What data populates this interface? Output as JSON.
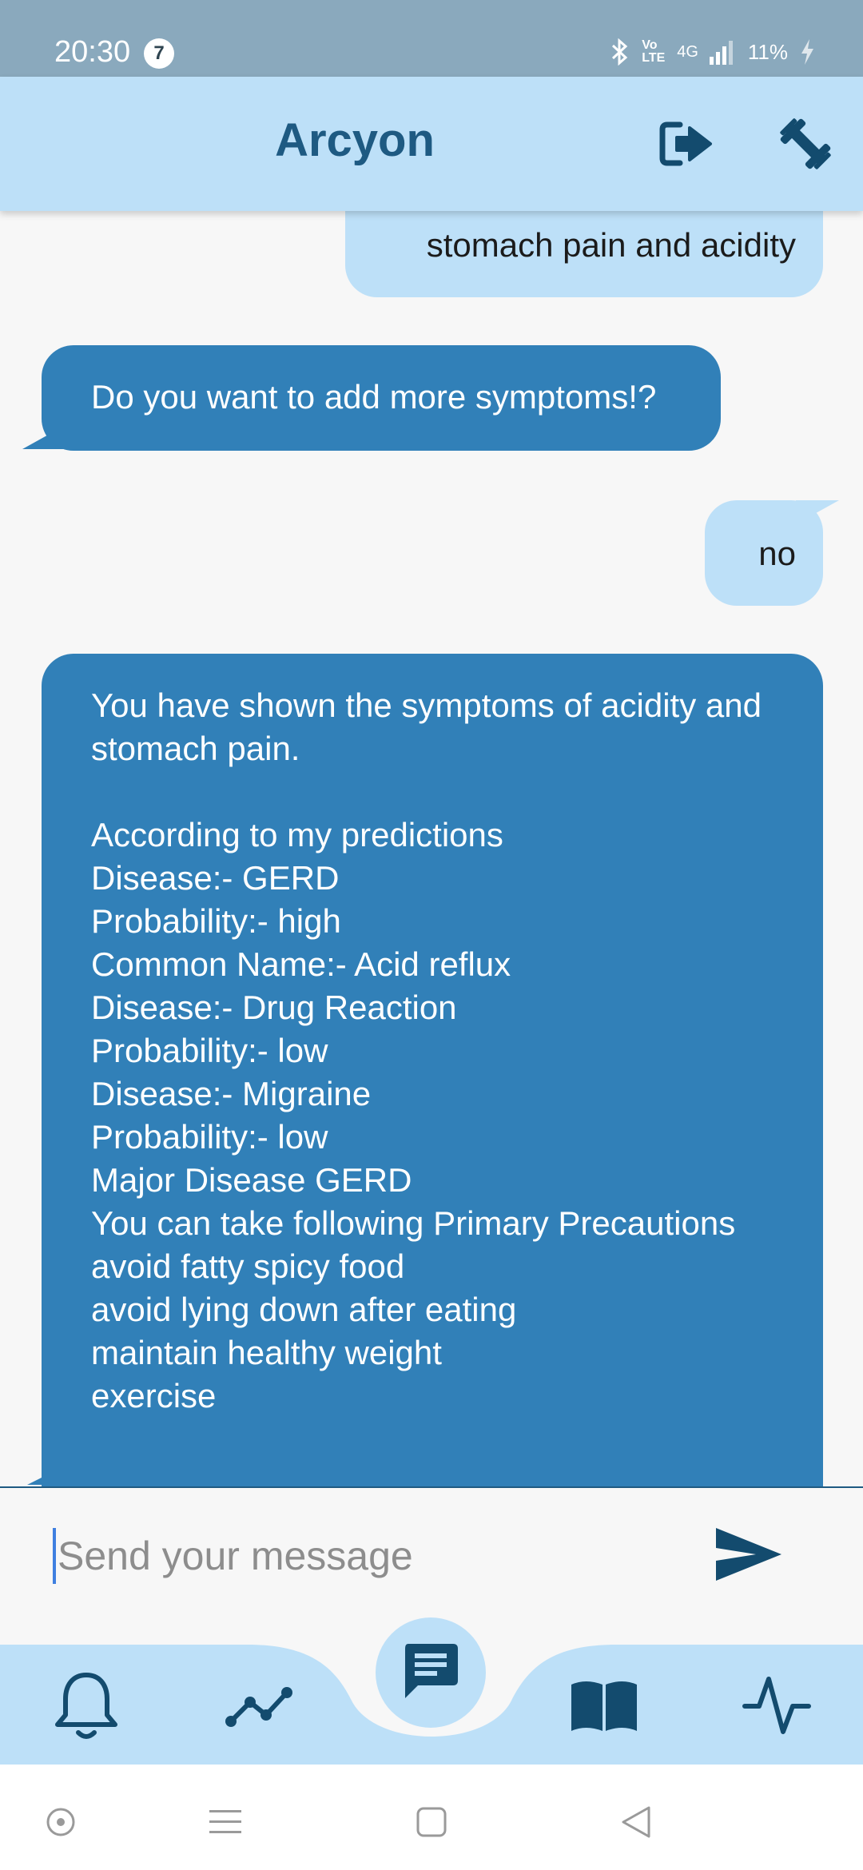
{
  "status_bar": {
    "time": "20:30",
    "notification_count": "7",
    "network": "4G",
    "volte": "Vo LTE",
    "battery": "11%"
  },
  "app_bar": {
    "title": "Arcyon",
    "actions": [
      "logout-icon",
      "fitness-icon"
    ]
  },
  "chat": {
    "messages": [
      {
        "sender": "user",
        "text": "stomach pain and acidity"
      },
      {
        "sender": "bot",
        "text": "Do you want to add more symptoms!?"
      },
      {
        "sender": "user",
        "text": "no"
      },
      {
        "sender": "bot",
        "text": "You have shown the symptoms of acidity and stomach pain.\n\nAccording to my predictions\nDisease:- GERD\nProbability:- high\nCommon Name:- Acid reflux\nDisease:- Drug Reaction\nProbability:- low\nDisease:- Migraine\nProbability:- low\nMajor Disease GERD\nYou can take following Primary Precautions\navoid fatty spicy food\navoid lying down after eating\nmaintain healthy weight\nexercise"
      }
    ]
  },
  "input": {
    "placeholder": "Send your message",
    "value": ""
  },
  "bottom_nav": {
    "items": [
      "bell-icon",
      "trend-icon",
      "chat-icon",
      "book-icon",
      "pulse-icon"
    ],
    "selected": "chat-icon"
  },
  "colors": {
    "status_bar": "#8aa9bd",
    "app_bar": "#bde0f8",
    "primary_dark": "#1e5a82",
    "bot_bubble": "#3180b8",
    "user_bubble": "#bde0f8",
    "background": "#f7f7f7"
  }
}
